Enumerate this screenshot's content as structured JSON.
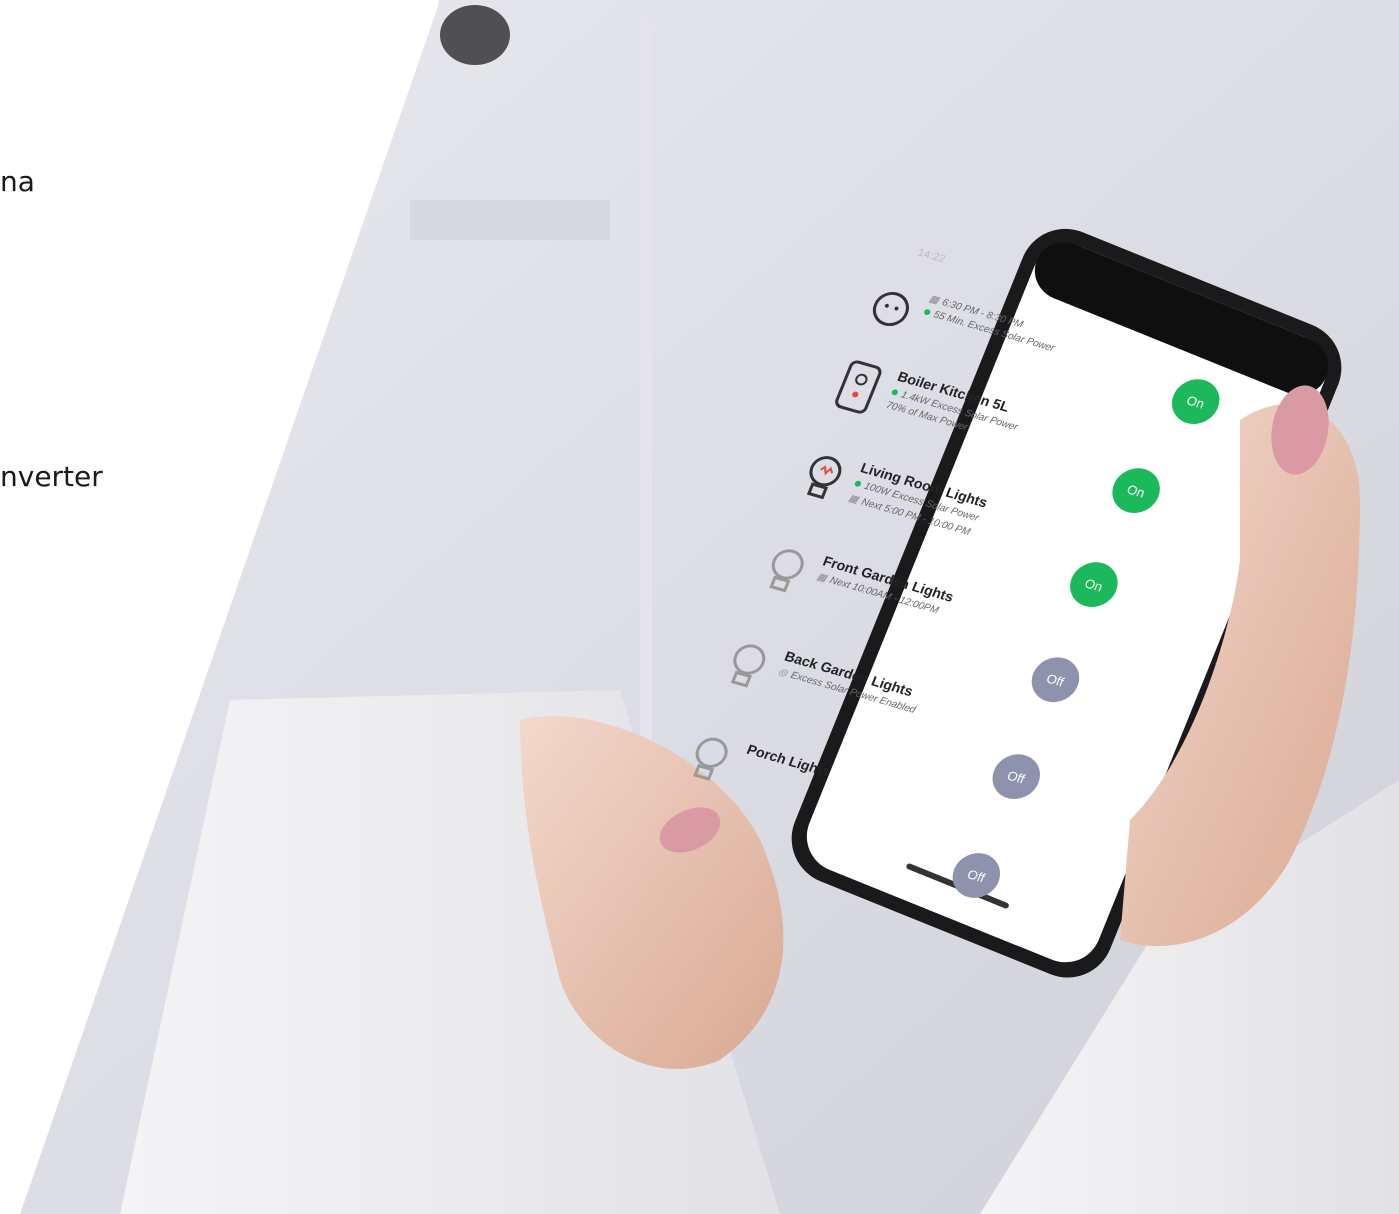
{
  "slide": {
    "line1": "na",
    "line2": "nverter"
  },
  "phone": {
    "status_time": "14:22",
    "items": [
      {
        "title": "",
        "sub1": "6:30 PM - 8:30 PM",
        "sub2": "55 Min. Excess Solar Power",
        "button": "On",
        "state": "on",
        "icon": "plug-icon"
      },
      {
        "title": "Boiler Kitchen 5L",
        "sub1": "1.4kW Excess Solar Power",
        "sub2": "70% of Max Power",
        "button": "On",
        "state": "on",
        "icon": "boiler-icon"
      },
      {
        "title": "Living Room Lights",
        "sub1": "100W Excess Solar Power",
        "sub2": "Next 5:00 PM - 10:00 PM",
        "button": "On",
        "state": "on",
        "icon": "bulb-icon"
      },
      {
        "title": "Front Garden Lights",
        "sub1": "Next 10:00AM - 12:00PM",
        "sub2": "",
        "button": "Off",
        "state": "off",
        "icon": "bulb-icon"
      },
      {
        "title": "Back Garden Lights",
        "sub1": "Excess Solar Power Enabled",
        "sub2": "",
        "button": "Off",
        "state": "off",
        "icon": "bulb-icon"
      },
      {
        "title": "Porch Lights",
        "sub1": "",
        "sub2": "",
        "button": "Off",
        "state": "off",
        "icon": "bulb-icon"
      }
    ]
  },
  "colors": {
    "on": "#1bb95b",
    "off": "#8d92ad",
    "topbar": "#122253"
  }
}
